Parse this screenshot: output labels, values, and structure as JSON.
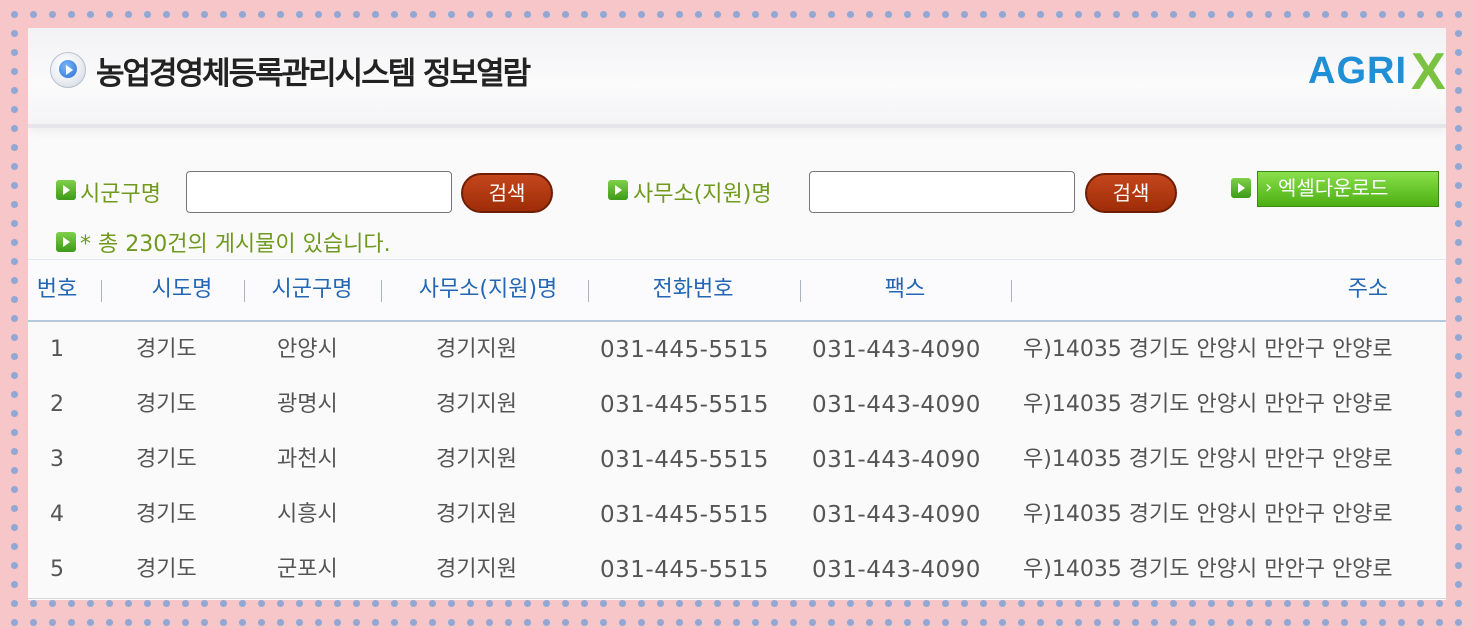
{
  "header": {
    "title": "농업경영체등록관리시스템 정보열람",
    "logo_text": "AGRI",
    "logo_mark": "X"
  },
  "search": {
    "district_label": "시군구명",
    "district_value": "",
    "office_label": "사무소(지원)명",
    "office_value": "",
    "search_button_label": "검색",
    "excel_button_label": "엑셀다운로드"
  },
  "summary": {
    "count_text": "* 총 230건의 게시물이 있습니다."
  },
  "table": {
    "columns": [
      "번호",
      "시도명",
      "시군구명",
      "사무소(지원)명",
      "전화번호",
      "팩스",
      "주소"
    ],
    "rows": [
      {
        "no": "1",
        "province": "경기도",
        "district": "안양시",
        "office": "경기지원",
        "phone": "031-445-5515",
        "fax": "031-443-4090",
        "address": "우)14035 경기도 안양시 만안구 안양로"
      },
      {
        "no": "2",
        "province": "경기도",
        "district": "광명시",
        "office": "경기지원",
        "phone": "031-445-5515",
        "fax": "031-443-4090",
        "address": "우)14035 경기도 안양시 만안구 안양로"
      },
      {
        "no": "3",
        "province": "경기도",
        "district": "과천시",
        "office": "경기지원",
        "phone": "031-445-5515",
        "fax": "031-443-4090",
        "address": "우)14035 경기도 안양시 만안구 안양로"
      },
      {
        "no": "4",
        "province": "경기도",
        "district": "시흥시",
        "office": "경기지원",
        "phone": "031-445-5515",
        "fax": "031-443-4090",
        "address": "우)14035 경기도 안양시 만안구 안양로"
      },
      {
        "no": "5",
        "province": "경기도",
        "district": "군포시",
        "office": "경기지원",
        "phone": "031-445-5515",
        "fax": "031-443-4090",
        "address": "우)14035 경기도 안양시 만안구 안양로"
      }
    ]
  },
  "colors": {
    "header_text": "#2367b4",
    "label_green": "#6f9a1e",
    "search_button": "#b13a12",
    "excel_button": "#5cbf1e"
  }
}
